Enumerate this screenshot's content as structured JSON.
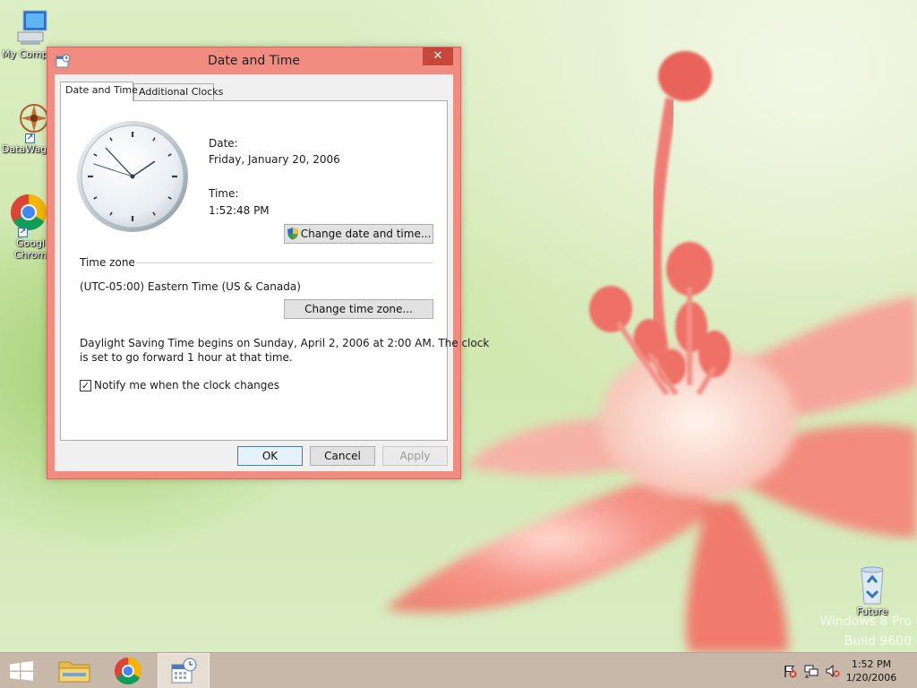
{
  "desktop": {
    "icons": [
      {
        "label": "My Comp",
        "icon": "computer-icon"
      },
      {
        "label": "DataWag",
        "icon": "datawag-icon"
      },
      {
        "label": "Googl Chrom",
        "icon": "chrome-icon"
      },
      {
        "label": "Future",
        "icon": "recycle-bin-icon"
      }
    ],
    "watermark_line1": "Windows 8 Pro",
    "watermark_line2": "Build 9600"
  },
  "dialog": {
    "title": "Date and Time",
    "close_glyph": "✕",
    "tabs": [
      {
        "label": "Date and Time",
        "active": true
      },
      {
        "label": "Additional Clocks",
        "active": false
      }
    ],
    "date_label": "Date:",
    "date_value": "Friday, January 20, 2006",
    "time_label": "Time:",
    "time_value": "1:52:48 PM",
    "clock": {
      "hours": 1,
      "minutes": 52,
      "seconds": 48
    },
    "change_date_button": "Change date and time...",
    "time_zone_heading": "Time zone",
    "time_zone_value": "(UTC-05:00) Eastern Time (US & Canada)",
    "change_zone_button": "Change time zone...",
    "dst_line1": "Daylight Saving Time begins on Sunday, April 2, 2006 at 2:00 AM. The clock",
    "dst_line2": "is set to go forward 1 hour at that time.",
    "notify_label": "Notify me when the clock changes",
    "notify_checked": true,
    "ok_button": "OK",
    "cancel_button": "Cancel",
    "apply_button": "Apply"
  },
  "taskbar": {
    "items": [
      "start-icon",
      "file-explorer-icon",
      "chrome-icon",
      "date-time-app-icon"
    ],
    "tray_icons": [
      "action-center-icon",
      "network-icon",
      "volume-muted-icon"
    ],
    "time": "1:52 PM",
    "date": "1/20/2006"
  },
  "colors": {
    "dialog_frame": "#f18c80",
    "close_button": "#c7473a",
    "taskbar": "#c7b8aa",
    "accent_flower": "#f2766b"
  }
}
